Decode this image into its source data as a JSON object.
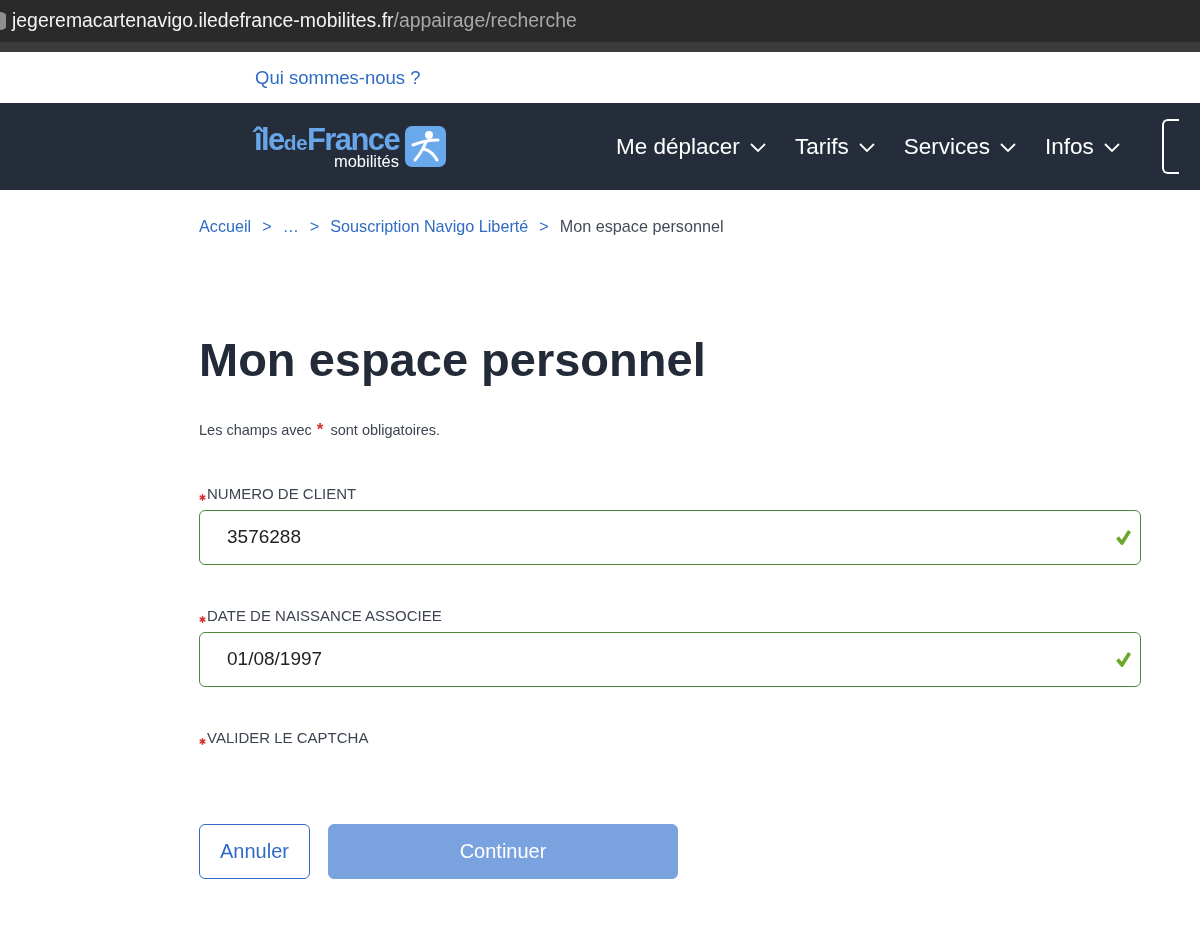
{
  "browser": {
    "url_host": "jegeremacartenavigo.iledefrance-mobilites.fr",
    "url_path": "/appairage/recherche"
  },
  "top_links": [
    "Qui sommes-nous ?"
  ],
  "logo": {
    "wordmark": [
      {
        "text": "île",
        "kind": "major"
      },
      {
        "text": "de",
        "kind": "minor"
      },
      {
        "text": "France",
        "kind": "major"
      }
    ],
    "tagline": "mobilités"
  },
  "nav": [
    {
      "label": "Me déplacer"
    },
    {
      "label": "Tarifs"
    },
    {
      "label": "Services"
    },
    {
      "label": "Infos"
    }
  ],
  "breadcrumb": [
    {
      "text": "Accueil",
      "kind": "link"
    },
    {
      "text": ">",
      "kind": "separator"
    },
    {
      "text": "…",
      "kind": "link"
    },
    {
      "text": ">",
      "kind": "separator"
    },
    {
      "text": "Souscription Navigo Liberté",
      "kind": "link"
    },
    {
      "text": ">",
      "kind": "separator"
    },
    {
      "text": "Mon espace personnel",
      "kind": "current"
    }
  ],
  "title": "Mon espace personnel",
  "required_note": {
    "before": "Les champs avec",
    "mark": "*",
    "after": "sont obligatoires."
  },
  "fields": [
    {
      "label": "NUMERO DE CLIENT",
      "required": true,
      "kind": "text",
      "value": "3576288",
      "valid": true
    },
    {
      "label": "DATE DE NAISSANCE ASSOCIEE",
      "required": true,
      "kind": "text",
      "value": "01/08/1997",
      "valid": true
    },
    {
      "label": "VALIDER LE CAPTCHA",
      "required": true,
      "kind": "captcha"
    }
  ],
  "buttons": [
    {
      "label": "Annuler",
      "kind": "outline",
      "disabled": false
    },
    {
      "label": "Continuer",
      "kind": "primary",
      "disabled": true
    }
  ]
}
